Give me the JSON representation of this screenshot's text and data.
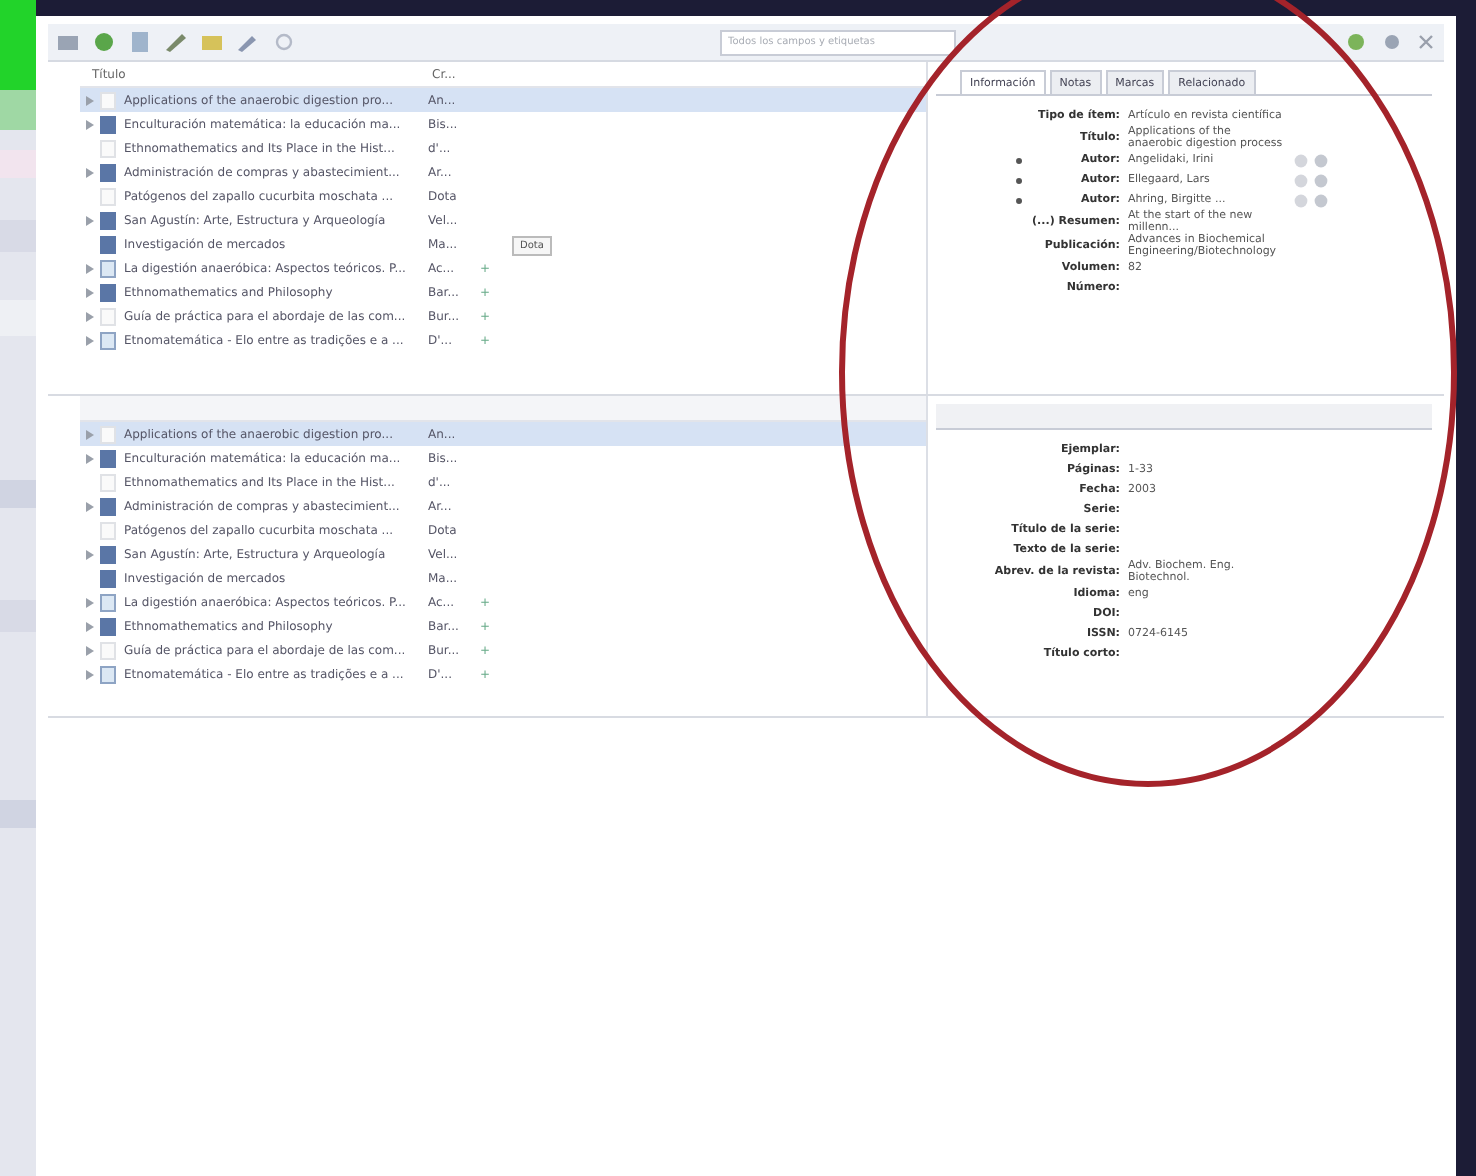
{
  "toolbar": {
    "search": {
      "placeholder": "Todos los campos y etiquetas"
    }
  },
  "top_list": {
    "columns": [
      "Título",
      "Cr..."
    ],
    "rows": [
      {
        "title": "Applications of the anaerobic digestion pro...",
        "creator": "An...",
        "kind": "article",
        "twisty": true,
        "selected": true
      },
      {
        "title": "Enculturación matemática: la educación ma...",
        "creator": "Bis...",
        "kind": "book",
        "twisty": true,
        "selected": false
      },
      {
        "title": "Ethnomathematics and Its Place in the Hist...",
        "creator": "d'...",
        "kind": "article",
        "twisty": false,
        "selected": false
      },
      {
        "title": "Administración de compras y abastecimient...",
        "creator": "Ar...",
        "kind": "book",
        "twisty": true,
        "selected": false
      },
      {
        "title": "Patógenos del zapallo cucurbita moschata ...",
        "creator": "Dota",
        "kind": "article",
        "twisty": false,
        "selected": false
      },
      {
        "title": "San Agustín: Arte, Estructura y Arqueología",
        "creator": "Vel...",
        "kind": "book",
        "twisty": true,
        "selected": false
      },
      {
        "title": "Investigación de mercados",
        "creator": "Ma...",
        "kind": "book",
        "twisty": false,
        "selected": false
      },
      {
        "title": "La digestión anaeróbica: Aspectos teóricos. P...",
        "creator": "Ac...",
        "kind": "document",
        "twisty": true,
        "selected": false,
        "column_3": "+"
      },
      {
        "title": "Ethnomathematics and Philosophy",
        "creator": "Bar...",
        "kind": "book",
        "twisty": true,
        "selected": false,
        "column_3": "+"
      },
      {
        "title": "Guía de práctica para el abordaje de las com...",
        "creator": "Bur...",
        "kind": "article",
        "twisty": true,
        "selected": false,
        "column_3": "+"
      },
      {
        "title": "Etnomatemática - Elo entre as tradições e a ...",
        "creator": "D'...",
        "kind": "document",
        "twisty": true,
        "selected": false,
        "column_3": "+"
      }
    ],
    "tooltip": "Dota"
  },
  "top_pane": {
    "tabs": [
      {
        "label": "Información",
        "selected": true
      },
      {
        "label": "Notas",
        "selected": false
      },
      {
        "label": "Marcas",
        "selected": false
      },
      {
        "label": "Relacionado",
        "selected": false
      }
    ],
    "fields": [
      {
        "label": "Tipo de ítem:",
        "value": "Artículo en revista científica",
        "kind": "text"
      },
      {
        "label": "Título:",
        "value": "Applications of the anaerobic digestion process",
        "kind": "text"
      },
      {
        "label": "Autor:",
        "value": "Angelidaki, Irini",
        "kind": "author"
      },
      {
        "label": "Autor:",
        "value": "Ellegaard, Lars",
        "kind": "author"
      },
      {
        "label": "Autor:",
        "value": "Ahring, Birgitte ...",
        "kind": "author"
      },
      {
        "label": "(...) Resumen:",
        "value": "At the start of the new millenn...",
        "kind": "text"
      },
      {
        "label": "Publicación:",
        "value": "Advances in Biochemical Engineering/Biotechnology",
        "kind": "text"
      },
      {
        "label": "Volumen:",
        "value": "82",
        "kind": "text"
      },
      {
        "label": "Número:",
        "kind": "text"
      }
    ]
  },
  "bottom_list": {
    "rows": [
      {
        "title": "Applications of the anaerobic digestion pro...",
        "creator": "An...",
        "kind": "article",
        "twisty": true,
        "selected": true
      },
      {
        "title": "Enculturación matemática: la educación ma...",
        "creator": "Bis...",
        "kind": "book",
        "twisty": true,
        "selected": false
      },
      {
        "title": "Ethnomathematics and Its Place in the Hist...",
        "creator": "d'...",
        "kind": "article",
        "twisty": false,
        "selected": false
      },
      {
        "title": "Administración de compras y abastecimient...",
        "creator": "Ar...",
        "kind": "book",
        "twisty": true,
        "selected": false
      },
      {
        "title": "Patógenos del zapallo cucurbita moschata ...",
        "creator": "Dota",
        "kind": "article",
        "twisty": false,
        "selected": false
      },
      {
        "title": "San Agustín: Arte, Estructura y Arqueología",
        "creator": "Vel...",
        "kind": "book",
        "twisty": true,
        "selected": false
      },
      {
        "title": "Investigación de mercados",
        "creator": "Ma...",
        "kind": "book",
        "twisty": false,
        "selected": false
      },
      {
        "title": "La digestión anaeróbica: Aspectos teóricos. P...",
        "creator": "Ac...",
        "kind": "document",
        "twisty": true,
        "selected": false,
        "column_3": "+"
      },
      {
        "title": "Ethnomathematics and Philosophy",
        "creator": "Bar...",
        "kind": "book",
        "twisty": true,
        "selected": false,
        "column_3": "+"
      },
      {
        "title": "Guía de práctica para el abordaje de las com...",
        "creator": "Bur...",
        "kind": "article",
        "twisty": true,
        "selected": false,
        "column_3": "+"
      },
      {
        "title": "Etnomatemática - Elo entre as tradições e a ...",
        "creator": "D'...",
        "kind": "document",
        "twisty": true,
        "selected": false,
        "column_3": "+"
      }
    ]
  },
  "bottom_pane": {
    "fields": [
      {
        "label": "Ejemplar:"
      },
      {
        "label": "Páginas:",
        "value": "1-33"
      },
      {
        "label": "Fecha:",
        "value": "2003"
      },
      {
        "label": "Serie:"
      },
      {
        "label": "Título de la serie:"
      },
      {
        "label": "Texto de la serie:"
      },
      {
        "label": "Abrev. de la revista:",
        "value": "Adv. Biochem. Eng. Biotechnol."
      },
      {
        "label": "Idioma:",
        "value": "eng"
      },
      {
        "label": "DOI:"
      },
      {
        "label": "ISSN:",
        "value": "0724-6145"
      },
      {
        "label": "Título corto:"
      }
    ]
  }
}
